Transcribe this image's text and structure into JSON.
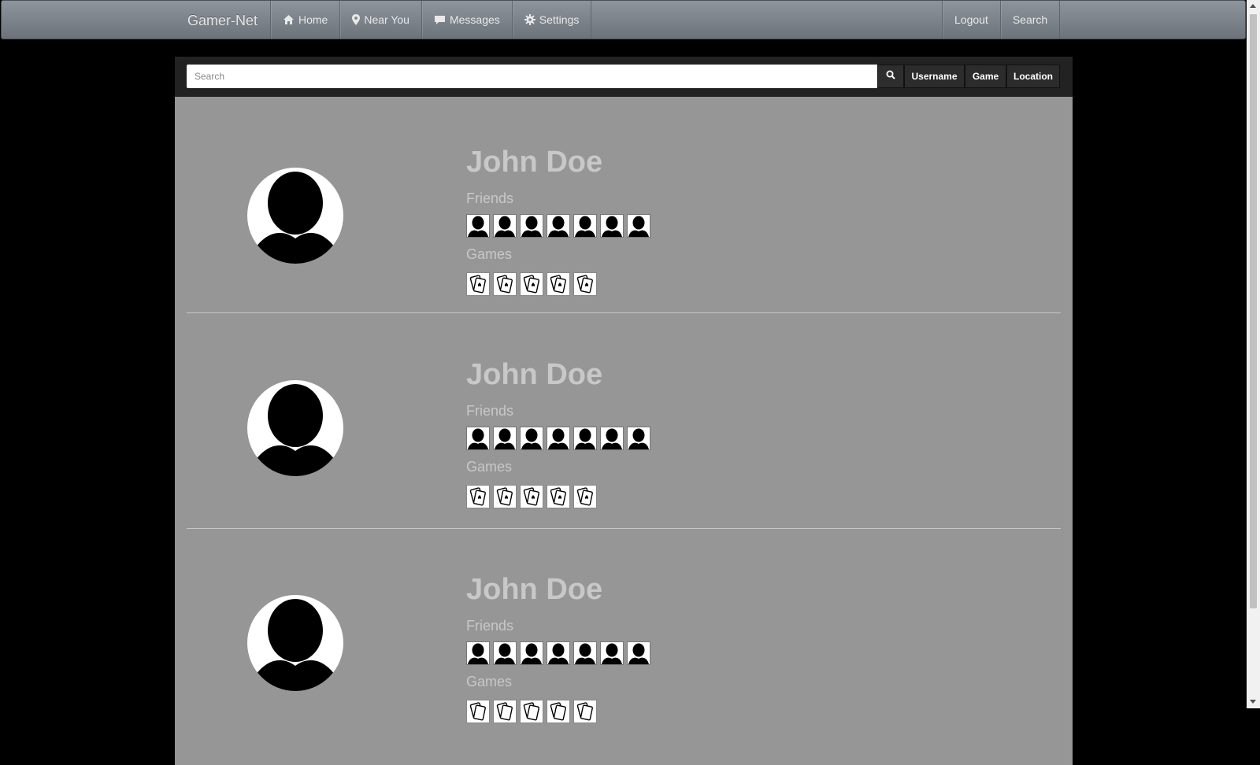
{
  "navbar": {
    "brand": "Gamer-Net",
    "left_items": [
      {
        "label": "Home",
        "icon": "home-icon"
      },
      {
        "label": "Near You",
        "icon": "map-marker-icon"
      },
      {
        "label": "Messages",
        "icon": "comment-icon"
      },
      {
        "label": "Settings",
        "icon": "gear-icon"
      }
    ],
    "right_items": [
      {
        "label": "Logout"
      },
      {
        "label": "Search"
      }
    ]
  },
  "search": {
    "placeholder": "Search",
    "value": "",
    "search_button_icon": "search-icon",
    "filters": [
      "Username",
      "Game",
      "Location"
    ]
  },
  "results": [
    {
      "name": "John Doe",
      "friends_label": "Friends",
      "friend_count": 7,
      "games_label": "Games",
      "game_count": 5
    },
    {
      "name": "John Doe",
      "friends_label": "Friends",
      "friend_count": 7,
      "games_label": "Games",
      "game_count": 5
    },
    {
      "name": "John Doe",
      "friends_label": "Friends",
      "friend_count": 7,
      "games_label": "Games",
      "game_count": 5
    }
  ],
  "colors": {
    "page_background": "#000000",
    "panel_background": "#969696",
    "navbar_top": "#8d949b",
    "navbar_bottom": "#6c737a",
    "muted_text": "#c8c8c8"
  }
}
